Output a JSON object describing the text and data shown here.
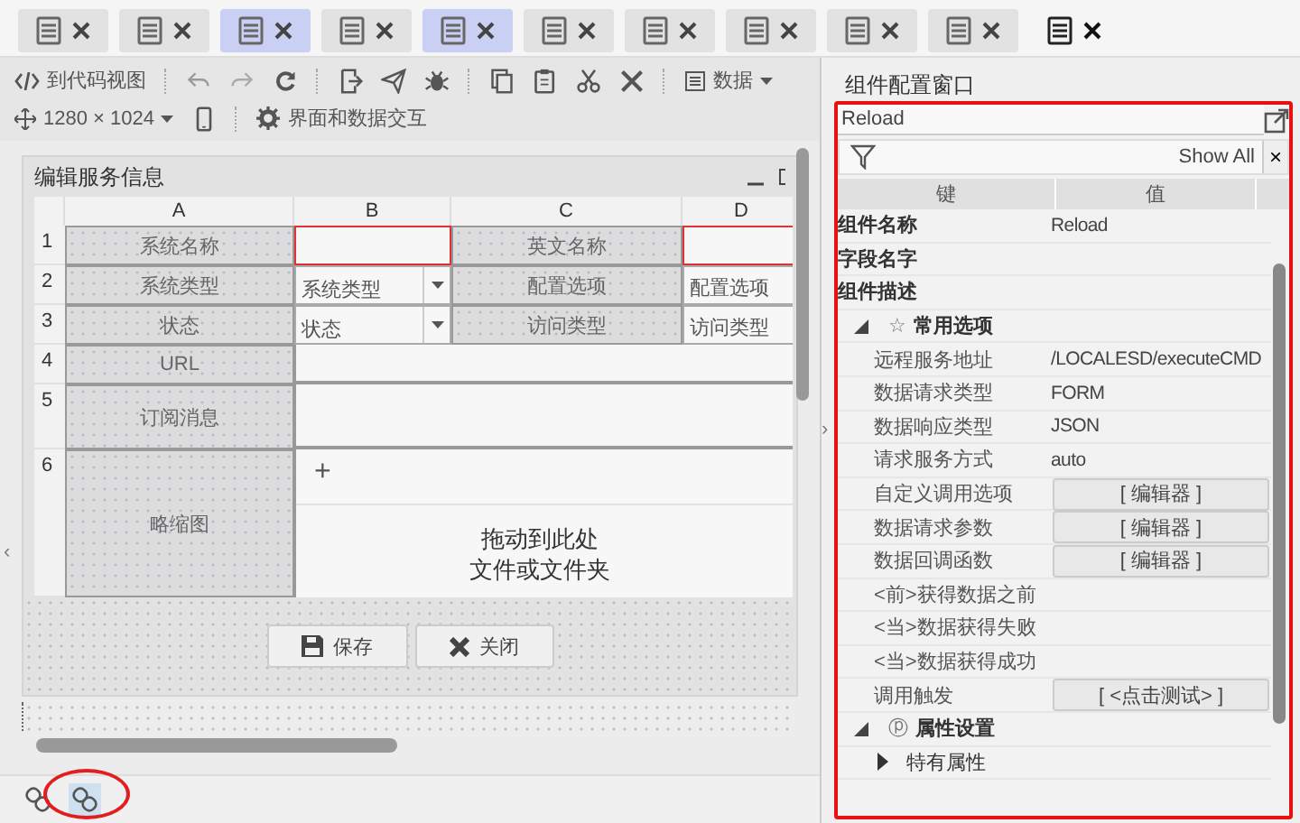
{
  "tabs": [
    {
      "selected": false,
      "highlighted": false
    },
    {
      "selected": false,
      "highlighted": false
    },
    {
      "selected": false,
      "highlighted": true
    },
    {
      "selected": false,
      "highlighted": false
    },
    {
      "selected": false,
      "highlighted": true
    },
    {
      "selected": false,
      "highlighted": false
    },
    {
      "selected": false,
      "highlighted": false
    },
    {
      "selected": false,
      "highlighted": false
    },
    {
      "selected": false,
      "highlighted": false
    },
    {
      "selected": false,
      "highlighted": false
    },
    {
      "selected": true,
      "highlighted": false
    }
  ],
  "toolbar": {
    "code_view": "到代码视图",
    "data_menu": "数据",
    "resolution": "1280 × 1024",
    "interaction": "界面和数据交互"
  },
  "form": {
    "title": "编辑服务信息",
    "columns": [
      "A",
      "B",
      "C",
      "D"
    ],
    "rows": [
      {
        "number": "1",
        "cells": [
          {
            "kind": "label",
            "text": "系统名称"
          },
          {
            "kind": "input",
            "invalid": true
          },
          {
            "kind": "label",
            "text": "英文名称"
          },
          {
            "kind": "input",
            "invalid": true
          }
        ]
      },
      {
        "number": "2",
        "cells": [
          {
            "kind": "label",
            "text": "系统类型"
          },
          {
            "kind": "select",
            "placeholder": "系统类型"
          },
          {
            "kind": "label",
            "text": "配置选项"
          },
          {
            "kind": "input",
            "placeholder": "配置选项",
            "invalid": false
          }
        ]
      },
      {
        "number": "3",
        "cells": [
          {
            "kind": "label",
            "text": "状态"
          },
          {
            "kind": "select",
            "placeholder": "状态"
          },
          {
            "kind": "label",
            "text": "访问类型"
          },
          {
            "kind": "input",
            "placeholder": "访问类型",
            "invalid": false
          }
        ]
      },
      {
        "number": "4",
        "cells": [
          {
            "kind": "label",
            "text": "URL"
          },
          {
            "kind": "wide"
          }
        ]
      },
      {
        "number": "5",
        "cells": [
          {
            "kind": "label",
            "text": "订阅消息"
          },
          {
            "kind": "wide"
          }
        ]
      },
      {
        "number": "6",
        "cells": [
          {
            "kind": "label",
            "text": "略缩图"
          },
          {
            "kind": "upload",
            "add": "+",
            "hint": [
              "拖动到此处",
              "文件或文件夹"
            ]
          }
        ]
      }
    ],
    "buttons": [
      "保存",
      "关闭"
    ]
  },
  "views": [
    {
      "selected": false
    },
    {
      "selected": true
    }
  ],
  "panel": {
    "title": "组件配置窗口",
    "search": "Reload",
    "filter": "Show All",
    "clear": "×",
    "columns": [
      "键",
      "值"
    ],
    "properties": [
      {
        "kind": "field",
        "key": "组件名称",
        "value": "Reload"
      },
      {
        "kind": "field",
        "key": "字段名字"
      },
      {
        "kind": "field",
        "key": "组件描述"
      },
      {
        "kind": "group",
        "symbol": "☆",
        "label": "常用选项",
        "expanded": true,
        "children": [
          {
            "kind": "prop",
            "key": "远程服务地址",
            "value": "/LOCALESD/executeCMD"
          },
          {
            "kind": "prop",
            "key": "数据请求类型",
            "value": "FORM"
          },
          {
            "kind": "prop",
            "key": "数据响应类型",
            "value": "JSON"
          },
          {
            "kind": "prop",
            "key": "请求服务方式",
            "value": "auto"
          },
          {
            "kind": "editor",
            "key": "自定义调用选项",
            "value": "[  编辑器 ]"
          },
          {
            "kind": "editor",
            "key": "数据请求参数",
            "value": "[  编辑器 ]"
          },
          {
            "kind": "editor",
            "key": "数据回调函数",
            "value": "[  编辑器 ]"
          },
          {
            "kind": "prop",
            "key": "<前>获得数据之前"
          },
          {
            "kind": "prop",
            "key": "<当>数据获得失败"
          },
          {
            "kind": "prop",
            "key": "<当>数据获得成功"
          },
          {
            "kind": "editor",
            "key": "调用触发",
            "value": "[  <点击测试> ]"
          }
        ]
      },
      {
        "kind": "group",
        "symbol": "ⓟ",
        "label": "属性设置",
        "expanded": true,
        "children": [
          {
            "kind": "group",
            "label": "特有属性",
            "expanded": false
          }
        ]
      }
    ]
  },
  "side_arrows": [
    "‹",
    "›"
  ]
}
